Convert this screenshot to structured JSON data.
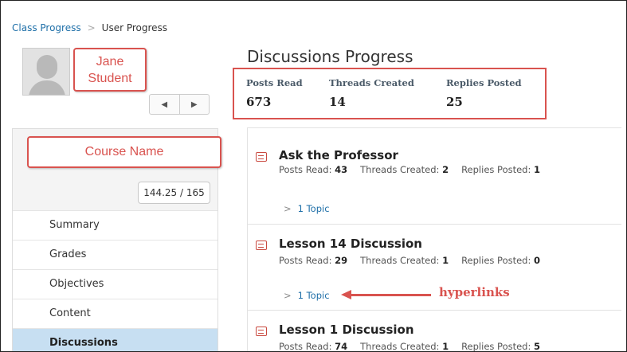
{
  "breadcrumb": {
    "link": "Class Progress",
    "current": "User Progress"
  },
  "user": {
    "name_callout": "Jane Student"
  },
  "pager": {
    "prev": "◀",
    "next": "▶"
  },
  "discussions_progress": {
    "title": "Discussions Progress",
    "stats": [
      {
        "label": "Posts Read",
        "value": "673"
      },
      {
        "label": "Threads Created",
        "value": "14"
      },
      {
        "label": "Replies Posted",
        "value": "25"
      }
    ]
  },
  "course": {
    "name_callout": "Course Name",
    "score": "144.25 / 165"
  },
  "nav": {
    "items": [
      {
        "label": "Summary"
      },
      {
        "label": "Grades"
      },
      {
        "label": "Objectives"
      },
      {
        "label": "Content"
      },
      {
        "label": "Discussions"
      }
    ]
  },
  "forums": [
    {
      "title": "Ask the Professor",
      "posts_read_label": "Posts Read:",
      "posts_read": "43",
      "threads_label": "Threads Created:",
      "threads": "2",
      "replies_label": "Replies Posted:",
      "replies": "1",
      "topic": "1 Topic"
    },
    {
      "title": "Lesson 14 Discussion",
      "posts_read_label": "Posts Read:",
      "posts_read": "29",
      "threads_label": "Threads Created:",
      "threads": "1",
      "replies_label": "Replies Posted:",
      "replies": "0",
      "topic": "1 Topic"
    },
    {
      "title": "Lesson 1 Discussion",
      "posts_read_label": "Posts Read:",
      "posts_read": "74",
      "threads_label": "Threads Created:",
      "threads": "1",
      "replies_label": "Replies Posted:",
      "replies": "5"
    }
  ],
  "annotation": {
    "label": "hyperlinks"
  },
  "colors": {
    "accent_red": "#d9534f",
    "link_blue": "#1e6fa8",
    "active_nav": "#c7dff2"
  },
  "icons": {
    "forum": "forum-speech-icon",
    "chevron": "chevron-right-icon"
  }
}
